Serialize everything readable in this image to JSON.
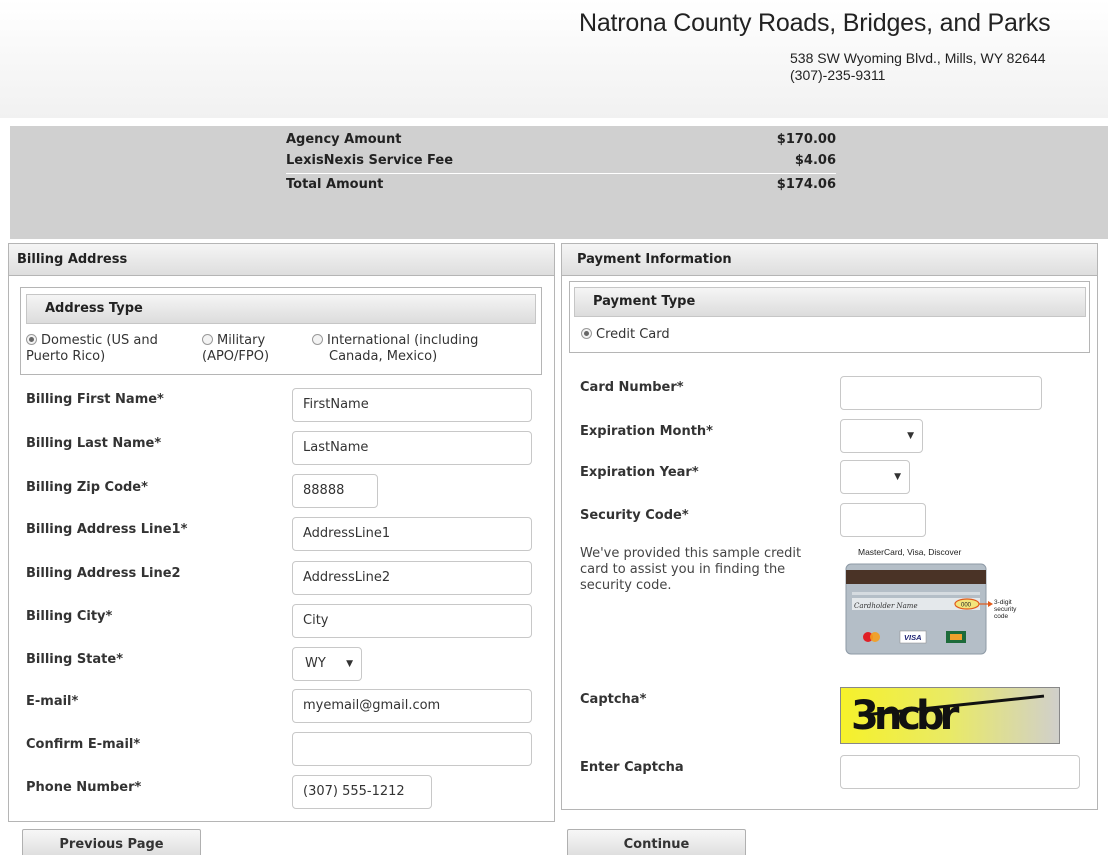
{
  "header": {
    "agency_name": "Natrona County Roads, Bridges, and Parks",
    "address": "538 SW Wyoming Blvd., Mills, WY 82644",
    "phone": "(307)-235-9311"
  },
  "summary": {
    "agency_label": "Agency Amount",
    "agency_amount": "$170.00",
    "fee_label": "LexisNexis Service Fee",
    "fee_amount": "$4.06",
    "total_label": "Total Amount",
    "total_amount": "$174.06"
  },
  "billing": {
    "title": "Billing Address",
    "address_type_title": "Address Type",
    "address_types": [
      {
        "label_line1": "Domestic (US and",
        "label_line2": "Puerto Rico)",
        "selected": true
      },
      {
        "label_line1": "Military",
        "label_line2": "(APO/FPO)",
        "selected": false
      },
      {
        "label_line1": "International (including",
        "label_line2": "Canada, Mexico)",
        "selected": false
      }
    ],
    "fields": {
      "first_name": {
        "label": "Billing First Name*",
        "value": "FirstName"
      },
      "last_name": {
        "label": "Billing Last Name*",
        "value": "LastName"
      },
      "zip": {
        "label": "Billing Zip Code*",
        "value": "88888"
      },
      "line1": {
        "label": "Billing Address Line1*",
        "value": "AddressLine1"
      },
      "line2": {
        "label": "Billing Address Line2",
        "value": "AddressLine2"
      },
      "city": {
        "label": "Billing City*",
        "value": "City"
      },
      "state": {
        "label": "Billing State*",
        "value": "WY"
      },
      "email": {
        "label": "E-mail*",
        "value": "myemail@gmail.com"
      },
      "confirm_email": {
        "label": "Confirm E-mail*",
        "value": ""
      },
      "phone": {
        "label": "Phone Number*",
        "value": "(307) 555-1212"
      }
    }
  },
  "payment": {
    "title": "Payment Information",
    "payment_type_title": "Payment Type",
    "payment_type_option": "Credit Card",
    "card_number_label": "Card Number*",
    "card_number_value": "",
    "exp_month_label": "Expiration Month*",
    "exp_month_value": "",
    "exp_year_label": "Expiration Year*",
    "exp_year_value": "",
    "security_code_label": "Security Code*",
    "security_code_value": "",
    "security_note": "We've provided this sample credit card to assist you in finding the security code.",
    "card_image": {
      "brands_caption": "MasterCard,  Visa,  Discover",
      "holder_text": "Cardholder Name",
      "cvv_sample": "000",
      "callout": "3-digit security code",
      "visa_label": "VISA"
    },
    "captcha_label": "Captcha*",
    "captcha_text": "3ncbr",
    "enter_captcha_label": "Enter Captcha",
    "enter_captcha_value": ""
  },
  "buttons": {
    "previous": "Previous Page",
    "continue": "Continue"
  }
}
